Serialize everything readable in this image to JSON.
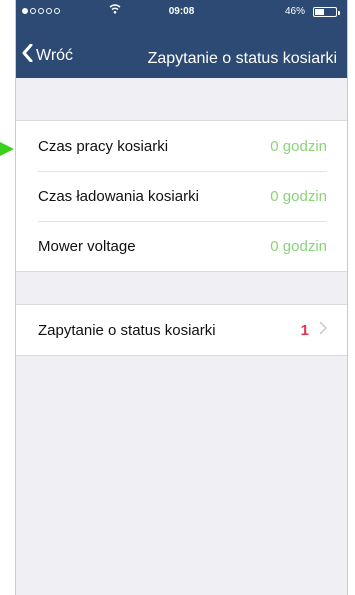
{
  "status_bar": {
    "time": "09:08",
    "battery": "46%",
    "battery_level": 0.46
  },
  "nav": {
    "back_label": "Wróć",
    "title": "Zapytanie o status kosiarki"
  },
  "status_rows": [
    {
      "label": "Czas pracy kosiarki",
      "value": "0 godzin"
    },
    {
      "label": "Czas ładowania kosiarki",
      "value": "0 godzin"
    },
    {
      "label": "Mower voltage",
      "value": "0 godzin"
    }
  ],
  "query_row": {
    "label": "Zapytanie o status kosiarki",
    "count": "1"
  },
  "colors": {
    "nav_bar": "#2c4a73",
    "value_green": "#8bd37a",
    "badge_red": "#e1364f",
    "pointer_green": "#39d01f"
  },
  "icons": {
    "back": "chevron-left-icon",
    "disclosure": "chevron-right-icon",
    "wifi": "wifi-icon",
    "battery": "battery-icon",
    "pointer": "arrow-right-icon"
  }
}
